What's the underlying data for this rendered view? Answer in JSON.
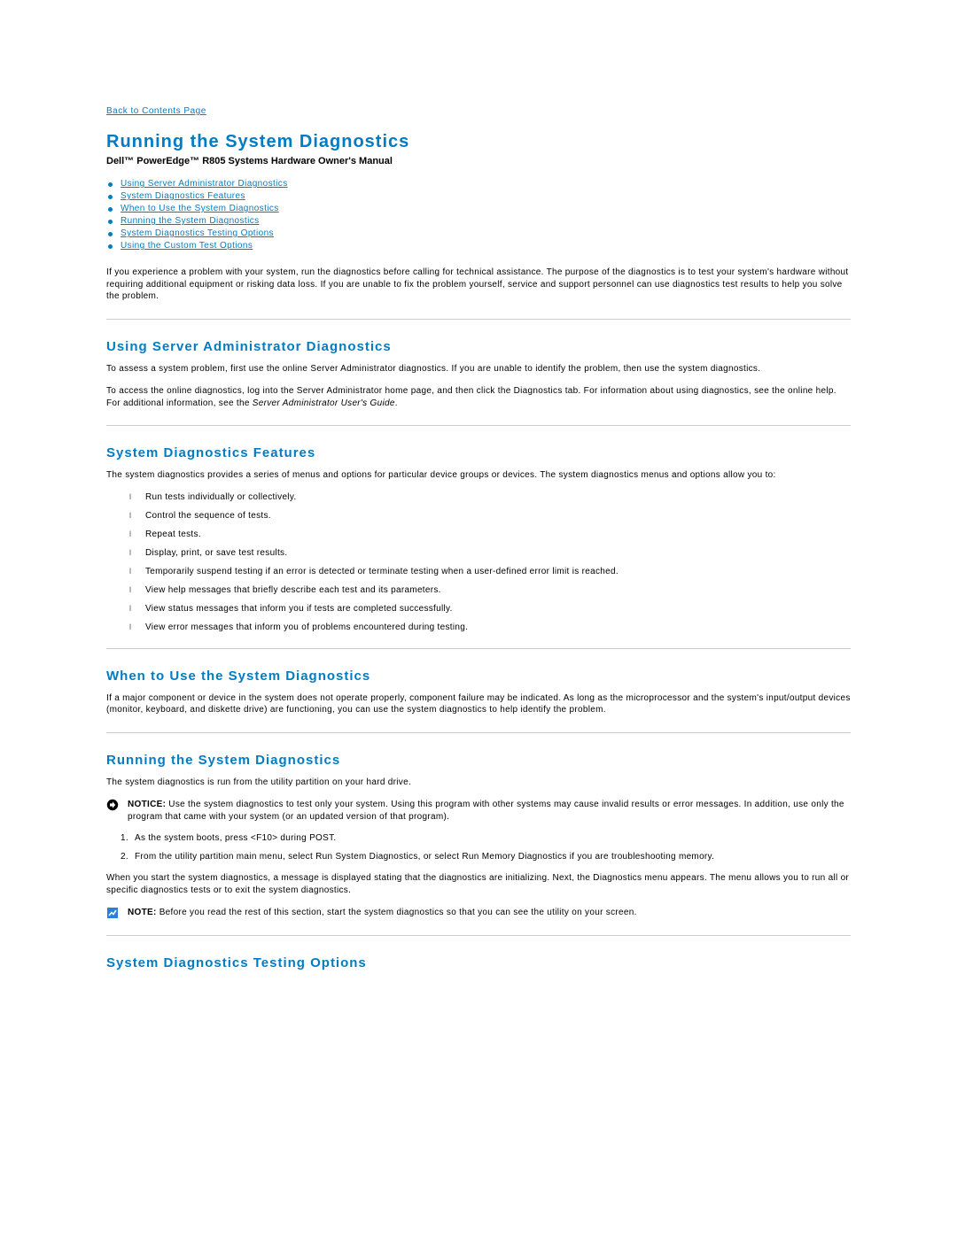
{
  "nav": {
    "back_link": "Back to Contents Page"
  },
  "title": "Running the System Diagnostics",
  "subtitle": "Dell™ PowerEdge™ R805 Systems Hardware Owner's Manual",
  "toc": [
    "Using Server Administrator Diagnostics",
    "System Diagnostics Features",
    "When to Use the System Diagnostics",
    "Running the System Diagnostics",
    "System Diagnostics Testing Options",
    "Using the Custom Test Options"
  ],
  "intro": "If you experience a problem with your system, run the diagnostics before calling for technical assistance. The purpose of the diagnostics is to test your system's hardware without requiring additional equipment or risking data loss. If you are unable to fix the problem yourself, service and support personnel can use diagnostics test results to help you solve the problem.",
  "sections": {
    "using_server_admin": {
      "heading": "Using Server Administrator Diagnostics",
      "p1": "To assess a system problem, first use the online Server Administrator diagnostics. If you are unable to identify the problem, then use the system diagnostics.",
      "p2_a": "To access the online diagnostics, log into the Server Administrator home page, and then click the Diagnostics tab. For information about using diagnostics, see the online help. For additional information, see the ",
      "p2_ital": "Server Administrator User's Guide",
      "p2_b": "."
    },
    "features": {
      "heading": "System Diagnostics Features",
      "p1": "The system diagnostics provides a series of menus and options for particular device groups or devices. The system diagnostics menus and options allow you to:",
      "items": [
        "Run tests individually or collectively.",
        "Control the sequence of tests.",
        "Repeat tests.",
        "Display, print, or save test results.",
        "Temporarily suspend testing if an error is detected or terminate testing when a user-defined error limit is reached.",
        "View help messages that briefly describe each test and its parameters.",
        "View status messages that inform you if tests are completed successfully.",
        "View error messages that inform you of problems encountered during testing."
      ]
    },
    "when": {
      "heading": "When to Use the System Diagnostics",
      "p1": "If a major component or device in the system does not operate properly, component failure may be indicated. As long as the microprocessor and the system's input/output devices (monitor, keyboard, and diskette drive) are functioning, you can use the system diagnostics to help identify the problem."
    },
    "running": {
      "heading": "Running the System Diagnostics",
      "p1": "The system diagnostics is run from the utility partition on your hard drive.",
      "notice_label": "NOTICE:",
      "notice_text": " Use the system diagnostics to test only your system. Using this program with other systems may cause invalid results or error messages. In addition, use only the program that came with your system (or an updated version of that program).",
      "steps": [
        "As the system boots, press <F10> during POST.",
        "From the utility partition main menu, select Run System Diagnostics, or select Run Memory Diagnostics if you are troubleshooting memory."
      ],
      "p2": "When you start the system diagnostics, a message is displayed stating that the diagnostics are initializing. Next, the Diagnostics menu appears. The menu allows you to run all or specific diagnostics tests or to exit the system diagnostics.",
      "note_label": "NOTE:",
      "note_text": " Before you read the rest of this section, start the system diagnostics so that you can see the utility on your screen."
    },
    "testing_options": {
      "heading": "System Diagnostics Testing Options"
    }
  }
}
